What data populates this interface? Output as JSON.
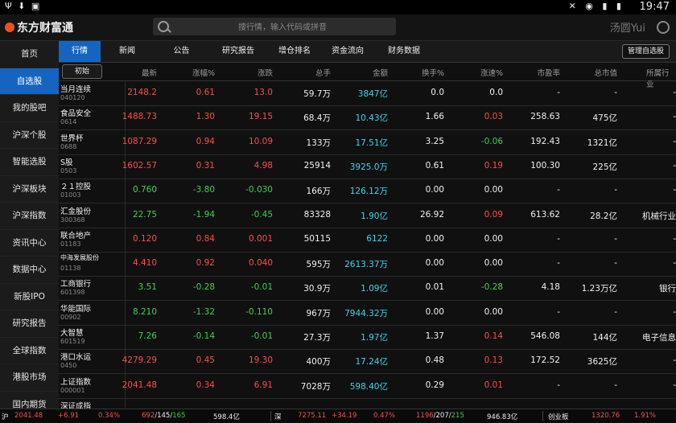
{
  "statusbar": {
    "left_icons": "Ψ ⬇ ▣",
    "sys_icons": "✕ ◉ ▮ ▮",
    "time": "19:47"
  },
  "app": {
    "logo": "东方财富通",
    "search_placeholder": "搜行情，输入代码或拼音",
    "user": "汤圆Yui"
  },
  "sidebar": {
    "items": [
      "首页",
      "自选股",
      "我的股吧",
      "沪深个股",
      "智能选股",
      "沪深板块",
      "沪深指数",
      "资讯中心",
      "数据中心",
      "新股IPO",
      "研究报告",
      "全球指数",
      "港股市场",
      "国内期货"
    ]
  },
  "tabs": [
    "行情",
    "新闻",
    "公告",
    "研究报告",
    "增仓排名",
    "资金流向",
    "财务数据"
  ],
  "manage_button": "管理自选股",
  "init_button": "初始",
  "headers": [
    "最新",
    "涨幅%",
    "涨跌",
    "总手",
    "金额",
    "换手%",
    "涨速%",
    "市盈率",
    "总市值",
    "所属行业"
  ],
  "rows": [
    {
      "name": "当月连续",
      "code": "040120",
      "last": "2148.2",
      "pct": "0.61",
      "chg": "13.0",
      "vol": "59.7万",
      "amt": "3847亿",
      "turn": "0.0",
      "speed": "0.0",
      "pe": "-",
      "cap": "-",
      "ind": "-",
      "cls": "red",
      "scls": "white"
    },
    {
      "name": "食品安全",
      "code": "0614",
      "last": "1488.73",
      "pct": "1.30",
      "chg": "19.15",
      "vol": "68.4万",
      "amt": "10.43亿",
      "turn": "1.66",
      "speed": "0.03",
      "pe": "258.63",
      "cap": "475亿",
      "ind": "-",
      "cls": "red",
      "scls": "red"
    },
    {
      "name": "世界杯",
      "code": "0688",
      "last": "1087.29",
      "pct": "0.94",
      "chg": "10.09",
      "vol": "133万",
      "amt": "17.51亿",
      "turn": "3.25",
      "speed": "-0.06",
      "pe": "192.43",
      "cap": "1321亿",
      "ind": "-",
      "cls": "red",
      "scls": "green"
    },
    {
      "name": "S股",
      "code": "0503",
      "last": "1602.57",
      "pct": "0.31",
      "chg": "4.98",
      "vol": "25914",
      "amt": "3925.0万",
      "turn": "0.61",
      "speed": "0.19",
      "pe": "100.30",
      "cap": "225亿",
      "ind": "-",
      "cls": "red",
      "scls": "red"
    },
    {
      "name": "２１控股",
      "code": "01003",
      "last": "0.760",
      "pct": "-3.80",
      "chg": "-0.030",
      "vol": "166万",
      "amt": "126.12万",
      "turn": "0.00",
      "speed": "0.00",
      "pe": "-",
      "cap": "-",
      "ind": "-",
      "cls": "green",
      "scls": "white"
    },
    {
      "name": "汇金股份",
      "code": "300368",
      "last": "22.75",
      "pct": "-1.94",
      "chg": "-0.45",
      "vol": "83328",
      "amt": "1.90亿",
      "turn": "26.92",
      "speed": "0.09",
      "pe": "613.62",
      "cap": "28.2亿",
      "ind": "机械行业",
      "cls": "green",
      "scls": "red"
    },
    {
      "name": "联合地产",
      "code": "01183",
      "last": "0.120",
      "pct": "0.84",
      "chg": "0.001",
      "vol": "50115",
      "amt": "6122",
      "turn": "0.00",
      "speed": "0.00",
      "pe": "-",
      "cap": "-",
      "ind": "-",
      "cls": "red",
      "scls": "white"
    },
    {
      "name": "中海发展股份",
      "code": "01138",
      "last": "4.410",
      "pct": "0.92",
      "chg": "0.040",
      "vol": "595万",
      "amt": "2613.37万",
      "turn": "0.00",
      "speed": "0.00",
      "pe": "-",
      "cap": "-",
      "ind": "-",
      "cls": "red",
      "scls": "white"
    },
    {
      "name": "工商银行",
      "code": "601398",
      "last": "3.51",
      "pct": "-0.28",
      "chg": "-0.01",
      "vol": "30.9万",
      "amt": "1.09亿",
      "turn": "0.01",
      "speed": "-0.28",
      "pe": "4.18",
      "cap": "1.23万亿",
      "ind": "银行",
      "cls": "green",
      "scls": "green"
    },
    {
      "name": "华能国际",
      "code": "00902",
      "last": "8.210",
      "pct": "-1.32",
      "chg": "-0.110",
      "vol": "967万",
      "amt": "7944.32万",
      "turn": "0.00",
      "speed": "0.00",
      "pe": "-",
      "cap": "-",
      "ind": "-",
      "cls": "green",
      "scls": "white"
    },
    {
      "name": "大智慧",
      "code": "601519",
      "last": "7.26",
      "pct": "-0.14",
      "chg": "-0.01",
      "vol": "27.3万",
      "amt": "1.97亿",
      "turn": "1.37",
      "speed": "0.14",
      "pe": "546.08",
      "cap": "144亿",
      "ind": "电子信息",
      "cls": "green",
      "scls": "red"
    },
    {
      "name": "港口水运",
      "code": "0450",
      "last": "4279.29",
      "pct": "0.45",
      "chg": "19.30",
      "vol": "400万",
      "amt": "17.24亿",
      "turn": "0.48",
      "speed": "0.13",
      "pe": "172.52",
      "cap": "3625亿",
      "ind": "-",
      "cls": "red",
      "scls": "red"
    },
    {
      "name": "上证指数",
      "code": "000001",
      "last": "2041.48",
      "pct": "0.34",
      "chg": "6.91",
      "vol": "7028万",
      "amt": "598.40亿",
      "turn": "0.29",
      "speed": "0.01",
      "pe": "-",
      "cap": "-",
      "ind": "-",
      "cls": "red",
      "scls": "red"
    },
    {
      "name": "深证成指",
      "code": "",
      "last": "",
      "pct": "",
      "chg": "",
      "vol": "",
      "amt": "",
      "turn": "",
      "speed": "",
      "pe": "",
      "cap": "",
      "ind": "",
      "cls": "red",
      "scls": "red"
    }
  ],
  "bottom": {
    "sh_label": "沪",
    "sh_val": "2041.48",
    "sh_chg": "+6.91",
    "sh_pct": "0.34%",
    "sh_breadth_up": "692",
    "sh_breadth_flat": "145",
    "sh_breadth_down": "165",
    "sh_amt": "598.4亿",
    "sz_label": "深",
    "sz_val": "7275.11",
    "sz_chg": "+34.19",
    "sz_pct": "0.47%",
    "sz_breadth_up": "1196",
    "sz_breadth_flat": "207",
    "sz_breadth_down": "215",
    "sz_amt": "946.83亿",
    "cy_label": "创业板",
    "cy_val": "1320.76",
    "cy_pct": "1.91%"
  }
}
